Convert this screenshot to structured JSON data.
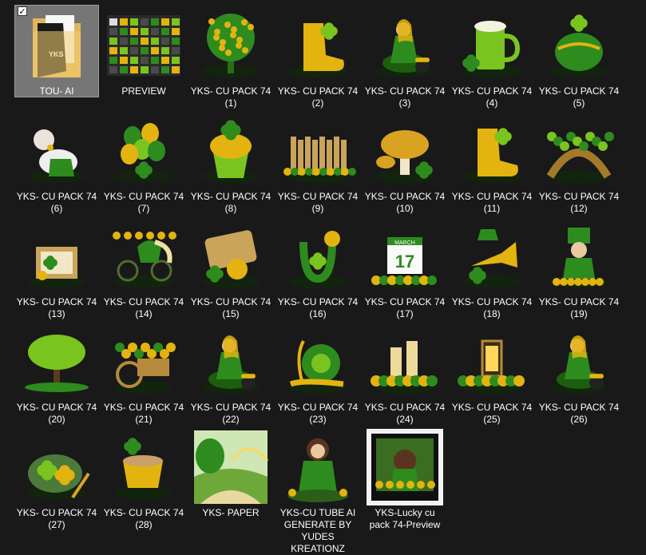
{
  "explorer": {
    "items": [
      {
        "label": "TOU- AI",
        "kind": "folder",
        "selected": true,
        "checked": true
      },
      {
        "label": "PREVIEW",
        "kind": "preview-sheet"
      },
      {
        "label": "YKS- CU PACK 74 (1)",
        "kind": "clipart",
        "motif": "tree"
      },
      {
        "label": "YKS- CU PACK 74 (2)",
        "kind": "clipart",
        "motif": "boot"
      },
      {
        "label": "YKS- CU PACK 74 (3)",
        "kind": "clipart",
        "motif": "fairy"
      },
      {
        "label": "YKS- CU PACK 74 (4)",
        "kind": "clipart",
        "motif": "mug"
      },
      {
        "label": "YKS- CU PACK 74 (5)",
        "kind": "clipart",
        "motif": "pot"
      },
      {
        "label": "YKS- CU PACK 74 (6)",
        "kind": "clipart",
        "motif": "cow"
      },
      {
        "label": "YKS- CU PACK 74 (7)",
        "kind": "clipart",
        "motif": "balloons"
      },
      {
        "label": "YKS- CU PACK 74 (8)",
        "kind": "clipart",
        "motif": "cupcake"
      },
      {
        "label": "YKS- CU PACK 74 (9)",
        "kind": "clipart",
        "motif": "fence"
      },
      {
        "label": "YKS- CU PACK 74 (10)",
        "kind": "clipart",
        "motif": "mushroom"
      },
      {
        "label": "YKS- CU PACK 74 (11)",
        "kind": "clipart",
        "motif": "boot"
      },
      {
        "label": "YKS- CU PACK 74 (12)",
        "kind": "clipart",
        "motif": "bridge"
      },
      {
        "label": "YKS- CU PACK 74 (13)",
        "kind": "clipart",
        "motif": "frame"
      },
      {
        "label": "YKS- CU PACK 74 (14)",
        "kind": "clipart",
        "motif": "bike"
      },
      {
        "label": "YKS- CU PACK 74 (15)",
        "kind": "clipart",
        "motif": "banner"
      },
      {
        "label": "YKS- CU PACK 74 (16)",
        "kind": "clipart",
        "motif": "horseshoe"
      },
      {
        "label": "YKS- CU PACK 74 (17)",
        "kind": "clipart",
        "motif": "calendar"
      },
      {
        "label": "YKS- CU PACK 74 (18)",
        "kind": "clipart",
        "motif": "trumpet"
      },
      {
        "label": "YKS- CU PACK 74 (19)",
        "kind": "clipart",
        "motif": "leprechaun"
      },
      {
        "label": "YKS- CU PACK 74 (20)",
        "kind": "clipart",
        "motif": "bigtree"
      },
      {
        "label": "YKS- CU PACK 74 (21)",
        "kind": "clipart",
        "motif": "cart"
      },
      {
        "label": "YKS- CU PACK 74 (22)",
        "kind": "clipart",
        "motif": "fairy"
      },
      {
        "label": "YKS- CU PACK 74 (23)",
        "kind": "clipart",
        "motif": "snail"
      },
      {
        "label": "YKS- CU PACK 74 (24)",
        "kind": "clipart",
        "motif": "candles"
      },
      {
        "label": "YKS- CU PACK 74 (25)",
        "kind": "clipart",
        "motif": "lantern"
      },
      {
        "label": "YKS- CU PACK 74 (26)",
        "kind": "clipart",
        "motif": "fairy"
      },
      {
        "label": "YKS- CU PACK 74 (27)",
        "kind": "clipart",
        "motif": "plate"
      },
      {
        "label": "YKS- CU PACK 74 (28)",
        "kind": "clipart",
        "motif": "cup"
      },
      {
        "label": "YKS- PAPER",
        "kind": "paper"
      },
      {
        "label": "YKS-CU TUBE AI GENERATE BY YUDES KREATIONZ",
        "kind": "tube"
      },
      {
        "label": "YKS-Lucky cu pack 74-Preview",
        "kind": "framed-preview"
      }
    ],
    "folder_logo_text": "YKS",
    "calendar_text": "17",
    "calendar_month": "MARCH",
    "colors": {
      "background": "#191919",
      "selected": "#767676",
      "green": "#2e8b1e",
      "lime": "#7ac41f",
      "gold": "#e3b310",
      "folder": "#f2cf72"
    }
  }
}
